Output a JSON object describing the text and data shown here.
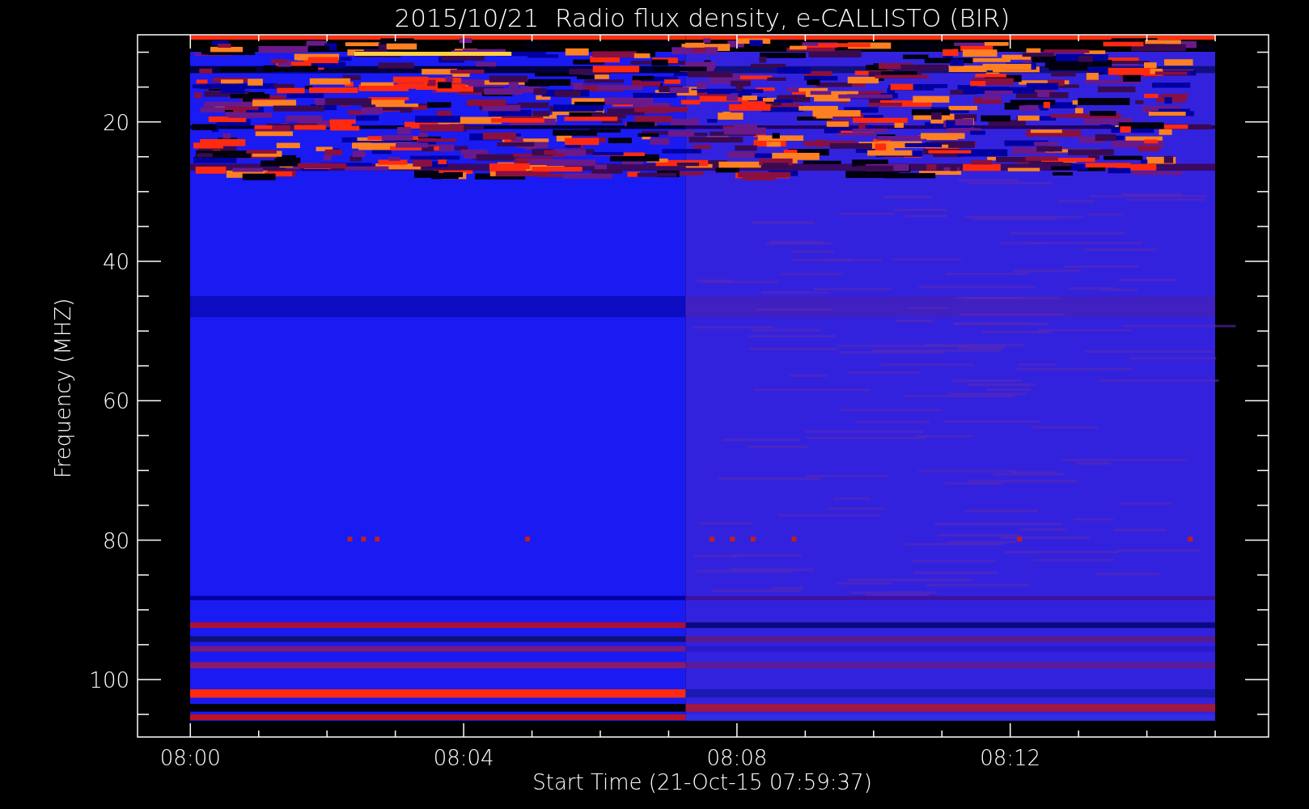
{
  "title": "2015/10/21  Radio flux density, e-CALLISTO (BIR)",
  "ylabel": "Frequency (MHZ)",
  "yticks": [
    "20",
    "40",
    "60",
    "80",
    "100"
  ],
  "xticks": [
    "08:00",
    "08:04",
    "08:08",
    "08:12"
  ],
  "xlabel": "Start Time (21-Oct-15 07:59:37)"
}
